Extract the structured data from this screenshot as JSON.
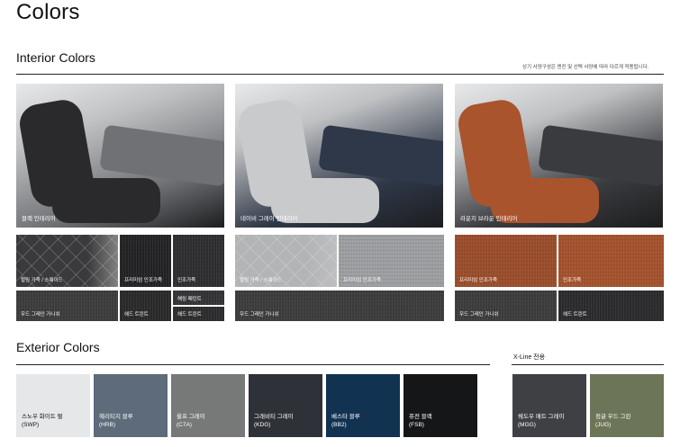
{
  "page_title": "Colors",
  "interior": {
    "section_title": "Interior Colors",
    "note": "상기 사양구성은 엔진 및 선택 사양에 따라 다르게 적용됩니다.",
    "main_images": [
      {
        "caption": "블랙 인테리어",
        "seat_color": "#2a2a2c",
        "bg": "#6f7174"
      },
      {
        "caption": "네이비 그레이 인테리어",
        "seat_color": "#c9cacb",
        "bg": "#2f3848"
      },
      {
        "caption": "라운지 브라운 인테리어",
        "seat_color": "#a9542d",
        "bg": "#3a3b3e"
      }
    ],
    "materials": {
      "black_row1": [
        {
          "label": "헐링 가죽 / 스웨이드",
          "color": "#3a3a3c"
        },
        {
          "label": "프리미엄 인조가죽",
          "color": "#232325"
        },
        {
          "label": "인조가죽",
          "color": "#2e2e30"
        }
      ],
      "black_row2": [
        {
          "label": "우드 그레인 가니쉬",
          "color": "#3c3c3c"
        },
        {
          "label": "헤드 트린트",
          "color": "#2a2a2a"
        },
        {
          "label": "해링 패턴트",
          "color": "#333335"
        },
        {
          "label": "헤드 트린트",
          "color": "#2c2c2e"
        }
      ],
      "navy_row1": [
        {
          "label": "헐링 가죽 / 스웨이드",
          "color": "#b3b4b6"
        },
        {
          "label": "프리미엄 인조가죽",
          "color": "#9c9ea1"
        }
      ],
      "navy_row2": [
        {
          "label": "우드 그레인 가니쉬",
          "color": "#3c3c3c"
        }
      ],
      "brown_row1": [
        {
          "label": "프리미엄 인조가죽",
          "color": "#9a4d2a"
        },
        {
          "label": "인조가죽",
          "color": "#a4522c"
        }
      ],
      "brown_row2": [
        {
          "label": "우드 그레인 가니쉬",
          "color": "#3c3c3c"
        },
        {
          "label": "헤드 트린트",
          "color": "#2b2b2d"
        }
      ]
    }
  },
  "exterior": {
    "section_title": "Exterior Colors",
    "xline_label": "X-Line 전용",
    "colors": [
      {
        "name": "스노우 화이트 펄",
        "code": "(SWP)",
        "hex": "#e6e7e8",
        "text": "#111111"
      },
      {
        "name": "헤리티지 블루",
        "code": "(HRB)",
        "hex": "#5d6b7a",
        "text": "#ffffff"
      },
      {
        "name": "울프 그레이",
        "code": "(C7A)",
        "hex": "#777878",
        "text": "#ffffff"
      },
      {
        "name": "그래비티 그레이",
        "code": "(KDG)",
        "hex": "#2e3137",
        "text": "#ffffff"
      },
      {
        "name": "베스타 블루",
        "code": "(BB2)",
        "hex": "#123252",
        "text": "#ffffff"
      },
      {
        "name": "퓨전 블랙",
        "code": "(FSB)",
        "hex": "#151617",
        "text": "#ffffff"
      }
    ],
    "xline_colors": [
      {
        "name": "쉐도우 매트 그레이",
        "code": "(MGG)",
        "hex": "#3f4043",
        "text": "#ffffff"
      },
      {
        "name": "정글 우드 그린",
        "code": "(JUG)",
        "hex": "#6d7558",
        "text": "#ffffff"
      }
    ]
  }
}
